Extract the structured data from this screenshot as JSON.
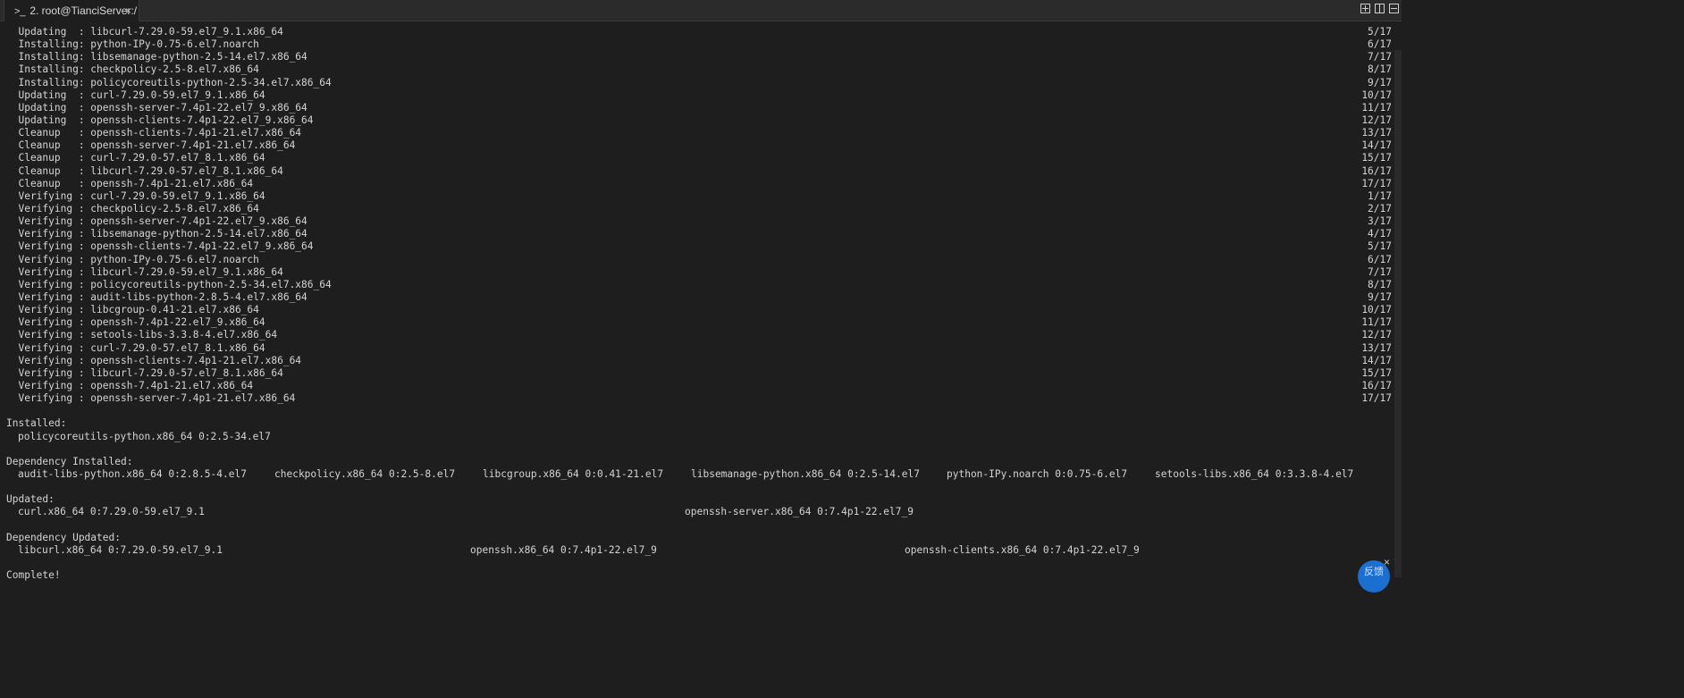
{
  "tab": {
    "title": "2. root@TianciServer:/",
    "prompt_glyph": ">_",
    "close_glyph": "×"
  },
  "transactions": [
    {
      "action": "Updating",
      "pkg": "libcurl-7.29.0-59.el7_9.1.x86_64",
      "counter": "5/17"
    },
    {
      "action": "Installing",
      "pkg": "python-IPy-0.75-6.el7.noarch",
      "counter": "6/17"
    },
    {
      "action": "Installing",
      "pkg": "libsemanage-python-2.5-14.el7.x86_64",
      "counter": "7/17"
    },
    {
      "action": "Installing",
      "pkg": "checkpolicy-2.5-8.el7.x86_64",
      "counter": "8/17"
    },
    {
      "action": "Installing",
      "pkg": "policycoreutils-python-2.5-34.el7.x86_64",
      "counter": "9/17"
    },
    {
      "action": "Updating",
      "pkg": "curl-7.29.0-59.el7_9.1.x86_64",
      "counter": "10/17"
    },
    {
      "action": "Updating",
      "pkg": "openssh-server-7.4p1-22.el7_9.x86_64",
      "counter": "11/17"
    },
    {
      "action": "Updating",
      "pkg": "openssh-clients-7.4p1-22.el7_9.x86_64",
      "counter": "12/17"
    },
    {
      "action": "Cleanup",
      "pkg": "openssh-clients-7.4p1-21.el7.x86_64",
      "counter": "13/17"
    },
    {
      "action": "Cleanup",
      "pkg": "openssh-server-7.4p1-21.el7.x86_64",
      "counter": "14/17"
    },
    {
      "action": "Cleanup",
      "pkg": "curl-7.29.0-57.el7_8.1.x86_64",
      "counter": "15/17"
    },
    {
      "action": "Cleanup",
      "pkg": "libcurl-7.29.0-57.el7_8.1.x86_64",
      "counter": "16/17"
    },
    {
      "action": "Cleanup",
      "pkg": "openssh-7.4p1-21.el7.x86_64",
      "counter": "17/17"
    },
    {
      "action": "Verifying",
      "pkg": "curl-7.29.0-59.el7_9.1.x86_64",
      "counter": "1/17"
    },
    {
      "action": "Verifying",
      "pkg": "checkpolicy-2.5-8.el7.x86_64",
      "counter": "2/17"
    },
    {
      "action": "Verifying",
      "pkg": "openssh-server-7.4p1-22.el7_9.x86_64",
      "counter": "3/17"
    },
    {
      "action": "Verifying",
      "pkg": "libsemanage-python-2.5-14.el7.x86_64",
      "counter": "4/17"
    },
    {
      "action": "Verifying",
      "pkg": "openssh-clients-7.4p1-22.el7_9.x86_64",
      "counter": "5/17"
    },
    {
      "action": "Verifying",
      "pkg": "python-IPy-0.75-6.el7.noarch",
      "counter": "6/17"
    },
    {
      "action": "Verifying",
      "pkg": "libcurl-7.29.0-59.el7_9.1.x86_64",
      "counter": "7/17"
    },
    {
      "action": "Verifying",
      "pkg": "policycoreutils-python-2.5-34.el7.x86_64",
      "counter": "8/17"
    },
    {
      "action": "Verifying",
      "pkg": "audit-libs-python-2.8.5-4.el7.x86_64",
      "counter": "9/17"
    },
    {
      "action": "Verifying",
      "pkg": "libcgroup-0.41-21.el7.x86_64",
      "counter": "10/17"
    },
    {
      "action": "Verifying",
      "pkg": "openssh-7.4p1-22.el7_9.x86_64",
      "counter": "11/17"
    },
    {
      "action": "Verifying",
      "pkg": "setools-libs-3.3.8-4.el7.x86_64",
      "counter": "12/17"
    },
    {
      "action": "Verifying",
      "pkg": "curl-7.29.0-57.el7_8.1.x86_64",
      "counter": "13/17"
    },
    {
      "action": "Verifying",
      "pkg": "openssh-clients-7.4p1-21.el7.x86_64",
      "counter": "14/17"
    },
    {
      "action": "Verifying",
      "pkg": "libcurl-7.29.0-57.el7_8.1.x86_64",
      "counter": "15/17"
    },
    {
      "action": "Verifying",
      "pkg": "openssh-7.4p1-21.el7.x86_64",
      "counter": "16/17"
    },
    {
      "action": "Verifying",
      "pkg": "openssh-server-7.4p1-21.el7.x86_64",
      "counter": "17/17"
    }
  ],
  "installed": {
    "heading": "Installed:",
    "items": [
      "policycoreutils-python.x86_64 0:2.5-34.el7"
    ]
  },
  "dependency_installed": {
    "heading": "Dependency Installed:",
    "items": [
      "audit-libs-python.x86_64 0:2.8.5-4.el7",
      "checkpolicy.x86_64 0:2.5-8.el7",
      "libcgroup.x86_64 0:0.41-21.el7",
      "libsemanage-python.x86_64 0:2.5-14.el7",
      "python-IPy.noarch 0:0.75-6.el7",
      "setools-libs.x86_64 0:3.3.8-4.el7"
    ]
  },
  "updated": {
    "heading": "Updated:",
    "items": [
      "curl.x86_64 0:7.29.0-59.el7_9.1",
      "openssh-server.x86_64 0:7.4p1-22.el7_9"
    ]
  },
  "dependency_updated": {
    "heading": "Dependency Updated:",
    "items": [
      "libcurl.x86_64 0:7.29.0-59.el7_9.1",
      "openssh.x86_64 0:7.4p1-22.el7_9",
      "openssh-clients.x86_64 0:7.4p1-22.el7_9"
    ]
  },
  "complete": "Complete!",
  "feedback": {
    "label": "反馈",
    "close_glyph": "×"
  },
  "colors": {
    "background": "#1e1e1e",
    "text": "#d4d4d4",
    "tabbar": "#2b2b2b",
    "feedback": "#1b6fd0"
  }
}
